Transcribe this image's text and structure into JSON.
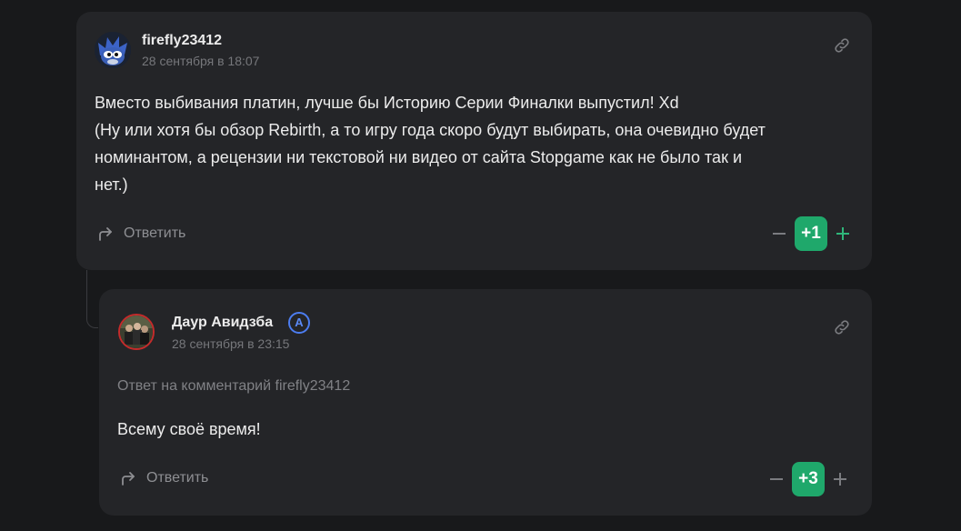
{
  "comments": [
    {
      "author": "firefly23412",
      "date": "28 сентября в 18:07",
      "avatar_icon": "hedgehog-avatar",
      "body_lines": [
        "Вместо выбивания платин, лучше бы Историю Серии Финалки выпустил! Xd",
        "(Ну или хотя бы обзор Rebirth, а то игру года скоро будут выбирать, она очевидно будет",
        "номинантом, а рецензии ни текстовой ни видео от сайта Stopgame как не было так и",
        "нет.)"
      ],
      "reply_label": "Ответить",
      "score": "+1",
      "score_color": "#1fa86b"
    },
    {
      "author": "Даур Авидзба",
      "author_badge": "A",
      "badge_color": "#4c7df0",
      "date": "28 сентября в 23:15",
      "avatar_icon": "group-photo-avatar",
      "reply_to_note": "Ответ на комментарий firefly23412",
      "body_lines": [
        "Всему своё время!"
      ],
      "reply_label": "Ответить",
      "score": "+3",
      "score_color": "#1fa86b"
    }
  ]
}
